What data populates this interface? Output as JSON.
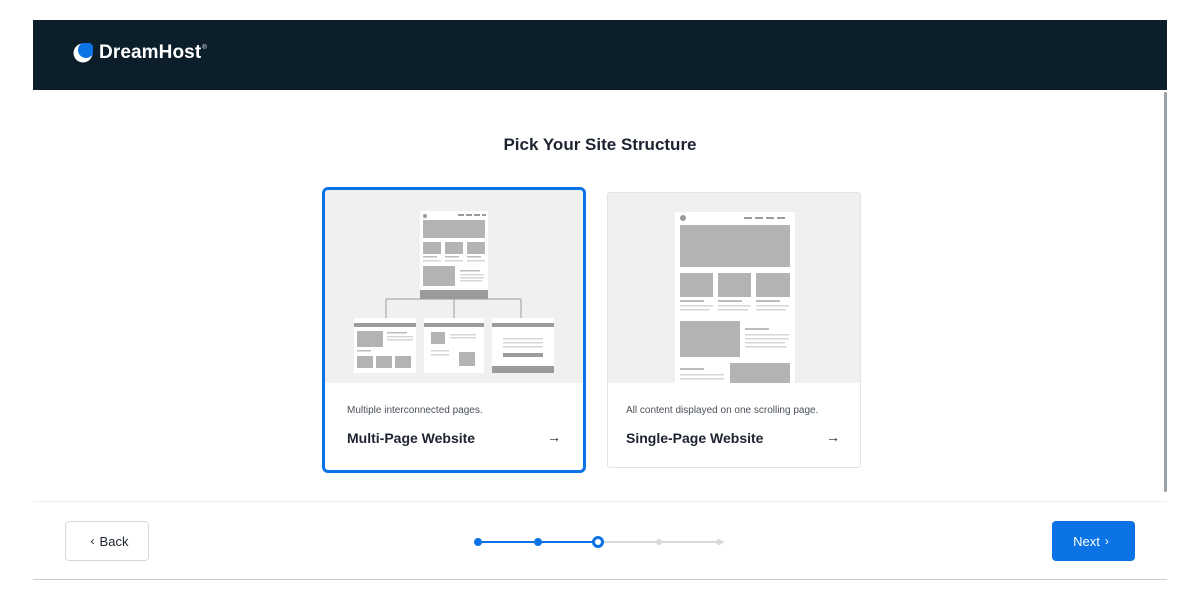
{
  "brand": {
    "name": "DreamHost",
    "reg_mark": "®",
    "accent": "#0b73e6",
    "header_bg": "#0b1e2a"
  },
  "page": {
    "title": "Pick Your Site Structure"
  },
  "options": [
    {
      "description": "Multiple interconnected pages.",
      "label": "Multi-Page Website",
      "arrow": "→",
      "selected": true
    },
    {
      "description": "All content displayed on one scrolling page.",
      "label": "Single-Page Website",
      "arrow": "→",
      "selected": false
    }
  ],
  "footer": {
    "back_label": "Back",
    "next_label": "Next",
    "back_icon": "chevron-left-icon",
    "next_icon": "chevron-right-icon",
    "steps_total": 5,
    "current_step": 3
  }
}
